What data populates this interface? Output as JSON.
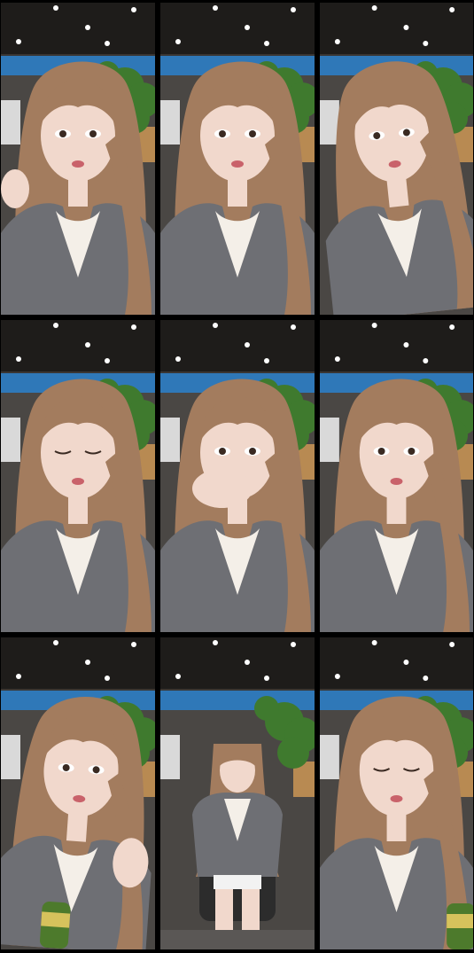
{
  "grid": {
    "rows": 3,
    "cols": 3,
    "tiles": [
      {
        "pose": "closeup-hand-left",
        "hand": true,
        "bottle": false
      },
      {
        "pose": "closeup-center",
        "hand": false,
        "bottle": false
      },
      {
        "pose": "closeup-tilt",
        "hand": false,
        "bottle": false
      },
      {
        "pose": "closeup-eyes-down",
        "hand": false,
        "bottle": false
      },
      {
        "pose": "hand-over-mouth",
        "hand": true,
        "bottle": false
      },
      {
        "pose": "closeup-center",
        "hand": false,
        "bottle": false
      },
      {
        "pose": "closeup-bottle",
        "hand": true,
        "bottle": true
      },
      {
        "pose": "full-body-chair",
        "hand": false,
        "bottle": false
      },
      {
        "pose": "closeup-eyes-closed",
        "hand": false,
        "bottle": true
      }
    ]
  },
  "colors": {
    "ceiling": "#1e1c1a",
    "wall": "#3a3633",
    "screen": "#2f78b8",
    "plant": "#3f7a2e",
    "hair": "#a37c5e",
    "skin": "#f1d8cc",
    "sweater": "#6e6f74",
    "camisole": "#f4efe8",
    "desk": "#b88a52"
  }
}
